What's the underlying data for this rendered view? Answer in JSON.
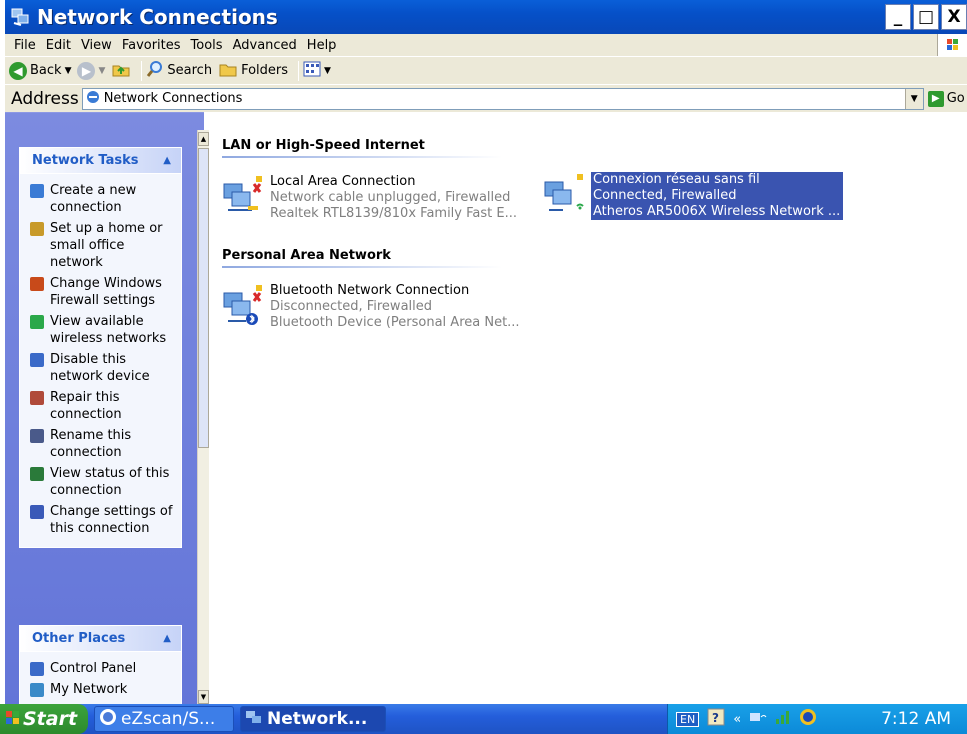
{
  "window": {
    "title": "Network Connections",
    "controls": {
      "minimize": "_",
      "restore": "□",
      "close": "X"
    }
  },
  "menu": [
    "File",
    "Edit",
    "View",
    "Favorites",
    "Tools",
    "Advanced",
    "Help"
  ],
  "toolbar": {
    "back_label": "Back",
    "search_label": "Search",
    "folders_label": "Folders"
  },
  "address": {
    "label": "Address",
    "value": "Network Connections",
    "go_label": "Go"
  },
  "left_pane": {
    "network_tasks": {
      "title": "Network Tasks",
      "items": [
        {
          "label": "Create a new connection",
          "icon": "new-connection-icon",
          "color": "#3a7bd5"
        },
        {
          "label": "Set up a home or small office network",
          "icon": "home-network-icon",
          "color": "#c89a2a"
        },
        {
          "label": "Change Windows Firewall settings",
          "icon": "firewall-icon",
          "color": "#c84a1a"
        },
        {
          "label": "View available wireless networks",
          "icon": "wireless-icon",
          "color": "#2aa84a"
        },
        {
          "label": "Disable this network device",
          "icon": "disable-icon",
          "color": "#3a6ac8"
        },
        {
          "label": "Repair this connection",
          "icon": "repair-icon",
          "color": "#b04a3a"
        },
        {
          "label": "Rename this connection",
          "icon": "rename-icon",
          "color": "#4a5a8a"
        },
        {
          "label": "View status of this connection",
          "icon": "status-icon",
          "color": "#2a7a3a"
        },
        {
          "label": "Change settings of this connection",
          "icon": "settings-icon",
          "color": "#3a5ab8"
        }
      ]
    },
    "other_places": {
      "title": "Other Places",
      "items": [
        {
          "label": "Control Panel",
          "icon": "control-panel-icon",
          "color": "#3a6ac8"
        },
        {
          "label": "My Network",
          "icon": "my-network-icon",
          "color": "#3a8ac8"
        }
      ]
    }
  },
  "groups": [
    {
      "title": "LAN or High-Speed Internet",
      "connections": [
        {
          "name": "Local Area Connection",
          "status": "Network cable unplugged, Firewalled",
          "device": "Realtek RTL8139/810x Family Fast E...",
          "state": "unplugged",
          "selected": false
        },
        {
          "name": "Connexion réseau sans fil",
          "status": "Connected, Firewalled",
          "device": "Atheros AR5006X Wireless Network ...",
          "state": "wireless",
          "selected": true
        }
      ]
    },
    {
      "title": "Personal Area Network",
      "connections": [
        {
          "name": "Bluetooth Network Connection",
          "status": "Disconnected, Firewalled",
          "device": "Bluetooth Device (Personal Area Net...",
          "state": "bluetooth",
          "selected": false
        }
      ]
    }
  ],
  "taskbar": {
    "start_label": "Start",
    "buttons": [
      {
        "label": "eZscan/S...",
        "active": false
      },
      {
        "label": "Network...",
        "active": true
      }
    ],
    "tray": {
      "language": "EN",
      "clock": "7:12 AM"
    }
  },
  "colors": {
    "titlebar": "#0650c8",
    "selection": "#3a54b0",
    "task_pane_header_text": "#215dc6"
  }
}
